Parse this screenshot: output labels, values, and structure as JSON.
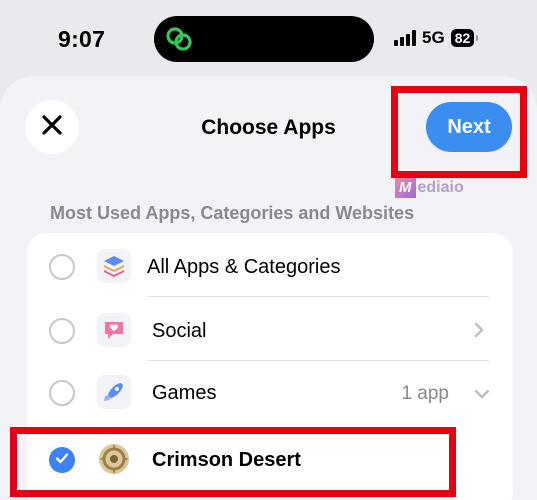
{
  "status_bar": {
    "time": "9:07",
    "network": "5G",
    "battery": "82"
  },
  "header": {
    "title": "Choose Apps",
    "next_label": "Next",
    "close_icon": "close-icon"
  },
  "watermark": {
    "logo_letter": "M",
    "text": "ediaio"
  },
  "section": {
    "title": "Most Used Apps, Categories and Websites"
  },
  "rows": [
    {
      "label": "All Apps & Categories",
      "icon": "stack-icon",
      "checked": false
    },
    {
      "label": "Social",
      "icon": "social-heart-icon",
      "checked": false,
      "accessory": "chevron-right"
    },
    {
      "label": "Games",
      "icon": "rocket-icon",
      "checked": false,
      "detail": "1 app",
      "accessory": "chevron-down"
    },
    {
      "label": "Crimson Desert",
      "icon": "crimson-desert-app-icon",
      "checked": true
    }
  ],
  "colors": {
    "accent_blue": "#3b8ef0",
    "highlight_red": "#e60012",
    "background": "#f2f2f7",
    "secondary_text": "#8a8a8e"
  }
}
